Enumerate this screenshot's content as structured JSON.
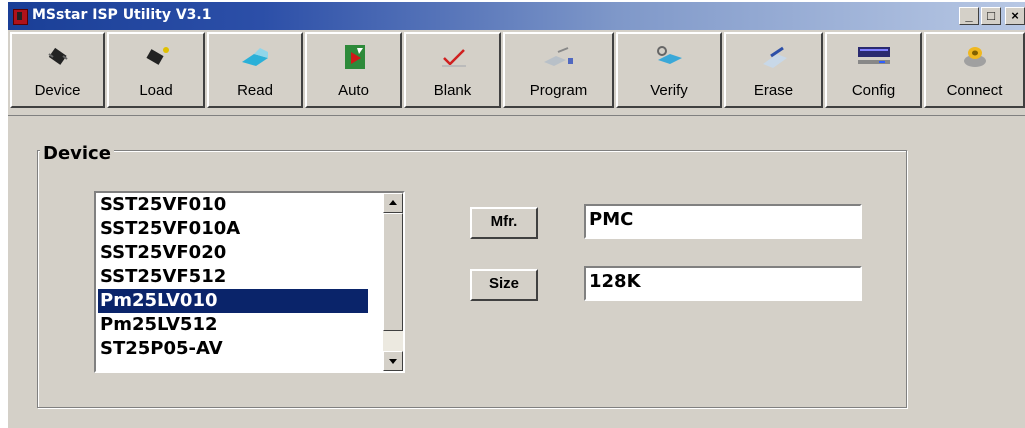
{
  "window": {
    "title": "MSstar ISP Utility V3.1",
    "caption_buttons": {
      "minimize": "_",
      "maximize": "□",
      "close": "×"
    }
  },
  "toolbar": {
    "buttons": [
      {
        "label": "Device",
        "icon": "chip-icon"
      },
      {
        "label": "Load",
        "icon": "chip-load-icon"
      },
      {
        "label": "Read",
        "icon": "read-icon"
      },
      {
        "label": "Auto",
        "icon": "auto-icon"
      },
      {
        "label": "Blank",
        "icon": "blank-check-icon"
      },
      {
        "label": "Program",
        "icon": "program-icon"
      },
      {
        "label": "Verify",
        "icon": "verify-icon"
      },
      {
        "label": "Erase",
        "icon": "erase-icon"
      },
      {
        "label": "Config",
        "icon": "config-icon"
      },
      {
        "label": "Connect",
        "icon": "connect-icon"
      }
    ]
  },
  "device_panel": {
    "legend": "Device",
    "list": [
      "SST25VF010",
      "SST25VF010A",
      "SST25VF020",
      "SST25VF512",
      "Pm25LV010",
      "Pm25LV512",
      "ST25P05-AV"
    ],
    "selected": "Pm25LV010",
    "mfr_label": "Mfr.",
    "mfr_value": "PMC",
    "size_label": "Size",
    "size_value": "128K"
  },
  "colors": {
    "title_bar": "#1a3f97",
    "selection": "#0a246a",
    "face": "#d4d0c8"
  }
}
